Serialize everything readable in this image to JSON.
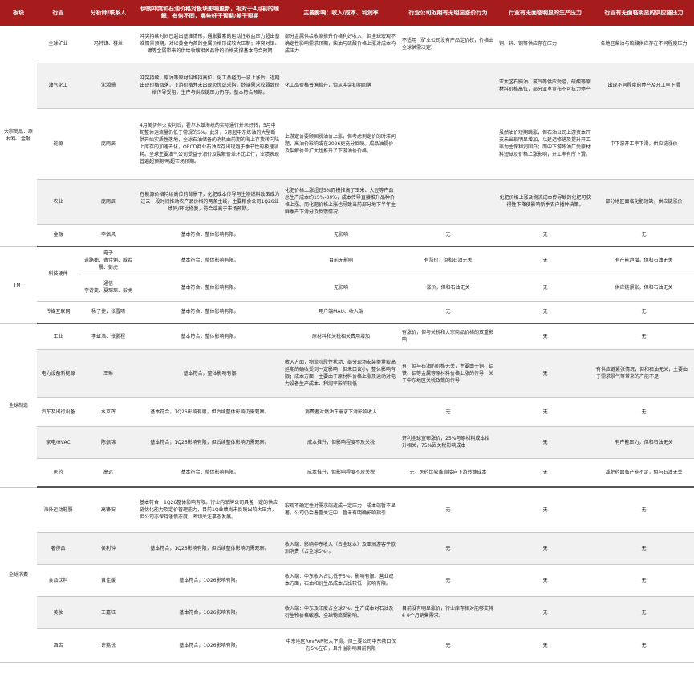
{
  "headers": [
    "板块",
    "行业",
    "分析师/联系人",
    "伊朗冲突和石油价格对板块影响更新，相对于4月初的理解，有何不同，哪些好于预期/差于预期",
    "主要影响：收入/成本、利润率",
    "行业公司近期有无明显涨价行为",
    "行业有无面临明显的生产压力",
    "行业有无面临明显的供应链压力"
  ],
  "sectors": {
    "commodities": "大宗商品、原材料、金融",
    "tmt": "TMT",
    "manufacturing": "全球制造",
    "consumer": "全球消费"
  },
  "rows": [
    {
      "industry": "全球矿业",
      "analyst": "冯韩锋、楼兰",
      "update": "冲突持续时间已超出基准情形，通胀要素的运动性收益压力超出基准情景预期，对以黄金为首的金属价格形成较大压制；冲突对铝、镍等金属带来的供给收缩相关品种的价格支撑基本符合预期",
      "impact": "部分金属供给收缩推升价格利好收入，但全球宏观不确定性影响需求预期，柴油与硫酸价格上涨对成本构成压力",
      "price": "不适用（矿业公司没有产品定价权，价格由全球供需决定）",
      "production": "铜、锌、铜等供应存在压力",
      "supply": "各地区柴油与硫酸供应存在不同程度压力"
    },
    {
      "industry": "油气化工",
      "analyst": "沈湘姗",
      "update": "冲突持续，原油等原材料维持高位，化工品经历一波上涨后，近期出现价格回落，下游价格并未出现恐慌或采购，终端需求较弱致价格传导受阻，生产与供应链压力仍存，基本符合预期。",
      "impact": "化工品价格普遍抬升，但从冲突初期回落",
      "price": "",
      "production": "亚太区石脑油、氯气等供应受阻，硫酸等原材料价格高位，部分亚室宣布不可抗力停产",
      "supply": "出现不同程度的停产及开工率下滑"
    },
    {
      "industry": "能源",
      "analyst": "庞雨辰",
      "update": "4月美伊停火谈判后，霍尔木兹海峡的实际通行并未好转，5月中旬整体运流量仍低于常规的5%。此外，5月起中东炼油的大型断供开始实质性落地，全球石油储备的消耗由前期的海上存货转向陆上库存的加速去化，OECD商业石油库存出现趋于季节性的极速消耗。全球主要油气公司受益于油价及裂解价差环比上行，业绩表现普遍超预期/略超市场预期。",
      "impact": "上游定价要顾固脱油价上涨，但考虑到定价的时滞问题，高油价影响或在2026更充分反映。成品油提价及裂解价差扩大也推升了下游油价价格。",
      "price": "",
      "production": "虽然油价短期跳涨，但石油公司上游资本开支未出现明显增加，以延迟修缮及提升开工率为主保利润固白；而中下游炼油厂受原材料短缺及价格上涨影响，开工率有所下滑。",
      "supply": "中下游开工率下滑，供应链涨价"
    },
    {
      "industry": "农业",
      "analyst": "庞雨辰",
      "update": "在能源价格持续高位的背景下，化肥成本传导与生物燃料政策成为过去一段时间推动农产品价格的两条主线，主要粮食公司1Q26业绩同/环比修复，符合或高于市场预期。",
      "impact": "化肥价格上涨超过5%而模推高了玉米、大豆等产品总生产成本约15%-30%，成本传导直接推升品种价格上涨。而化肥价格上涨也导致当前部分地下半年生鲜季产下滑分及反馈情况。",
      "price": "",
      "production": "化肥价格上涨及物流成本传导致的化肥可获得性下降使影响新季农户播种决策。",
      "supply": "部分地区面临化肥短缺，供应链涨价"
    },
    {
      "industry": "金融",
      "analyst": "李佩风",
      "update": "基本符合，整体影响有限。",
      "impact": "无影响",
      "price": "无",
      "production": "无",
      "supply": "无"
    },
    {
      "industry": "科技硬件",
      "sub_analysts": [
        {
          "group": "电子",
          "names": "道路蘅、曹佳俐、戚若晨、彭虎"
        },
        {
          "group": "通信",
          "names": "李诗变、夏琛琛、彭虎"
        }
      ],
      "subs": [
        {
          "update": "基本符合，整体影响有限。",
          "impact": "目前无影响",
          "price": "有涨价，但和石油无关",
          "production": "无",
          "supply": "有产能趋增，但和石油无关"
        },
        {
          "update": "基本符合，整体影响有限。",
          "impact": "无影响",
          "price": "涨价，但和石油无关",
          "production": "无",
          "supply": "供应链紧张，但和石油无关"
        }
      ]
    },
    {
      "industry": "传媒互联网",
      "analyst": "杨了捷，张雪晴",
      "update": "基本符合，整体影响有限。",
      "impact": "用户端MAU、收入端",
      "price": "无",
      "production": "无",
      "supply": "无"
    },
    {
      "industry": "工业",
      "analyst": "李虹浩、张鹏程",
      "update": "基本符合，整体影响有限。",
      "impact": "原材料和关税相关费用增加",
      "price": "有涨价，但与关税和大宗商品价格的双重影响",
      "production": "无",
      "supply": "无"
    },
    {
      "industry": "电力设备新能源",
      "analyst": "王琳",
      "update": "基本符合，整体影响有限",
      "impact": "收入方面，物流阶段性扰动、部分现场安装类量较高延期的确收受到一定影响，但未口议小，整体影响有限；成本方面，主要由于原材料价格上涨及运动对电力设备生产成本、利润率影响较低",
      "price": "有，但与石油的价格无关，主要由于铜、铝铁、铝等金属等原材料价格上涨的传导，关于中东地区关税政策的传导",
      "production": "无",
      "supply": "有供应链紧张情况，但和石油无关，主要由于需求景气等带来的产能不足"
    },
    {
      "industry": "汽车及出行设备",
      "analyst": "水京辉",
      "update": "基本符合，1Q26影响有限，但后续整体影响仍需观察。",
      "impact": "消费者对燃油车需求下滑影响收入",
      "price": "无",
      "production": "无",
      "supply": "无"
    },
    {
      "industry": "家电/HVAC",
      "analyst": "陈佩锦",
      "update": "基本符合，1Q26影响有限，但后续整体影响仍需观察。",
      "impact": "成本推升，但影响程度不及关税",
      "price": "开利全球宣布涨价，25%与原材料成本抬升相关，75%因关税影响成本",
      "production": "无",
      "supply": "有产能压力，但和石油无关"
    },
    {
      "industry": "医药",
      "analyst": "高远",
      "update": "基本符合，整体影响有限。",
      "impact": "成本推升，但影响程度不及关税",
      "price": "无，医药比较难直接向下游转嫁成本",
      "production": "无",
      "supply": "减肥药面临产能不足，但与石油无关"
    },
    {
      "industry": "海外运动鞋服",
      "analyst": "高锋安",
      "update": "基本符合，1Q26整体影响有限。行业内品牌公司具备一定的供应链优化能力及定价管理能力，目前1Q业绩尚未反映出较大压力，但公司亦保持谨慎态度，密切关注事态发展。",
      "impact": "宏观不确定性对需求端造成一定压力，成本端暂不显著，公司仍会着重关注中，暂未有明确影响指引",
      "price": "无",
      "production": "无",
      "supply": "无"
    },
    {
      "industry": "奢侈品",
      "analyst": "侯利钟",
      "update": "基本符合，1Q26影响有限，但后续整体影响仍需观察。",
      "impact": "收入端：影响中东收入（占全球本）及亚洲游客于欧洲消费（占全球5%）。",
      "price": "无",
      "production": "无",
      "supply": "无"
    },
    {
      "industry": "食品饮料",
      "analyst": "黄佳媛",
      "update": "基本符合，1Q26影响有限。",
      "impact": "收入端：中东收入占比低于5%，影响有限。营业成本方面，石油和衍生品成本占比较低，影响有限。",
      "price": "无",
      "production": "无",
      "supply": "无"
    },
    {
      "industry": "美妆",
      "analyst": "王嘉钰",
      "update": "基本符合，1Q26影响有限。",
      "impact": "收入端：中东及印度占全球7%，生产成本对石油及衍生物价格敏感，全球物流受影响。",
      "price": "目前没有明显涨价，行业库存相对能够支持6-9个月销售需求。",
      "production": "无",
      "supply": "无"
    },
    {
      "industry": "酒店",
      "analyst": "许荔悦",
      "update": "基本符合，1Q26影响有限。",
      "impact": "中东地区RevPAR较大下滑，但主要公司中东敞口仅在5%左右，且外溢影响目前有限",
      "price": "无",
      "production": "无",
      "supply": "无"
    }
  ]
}
